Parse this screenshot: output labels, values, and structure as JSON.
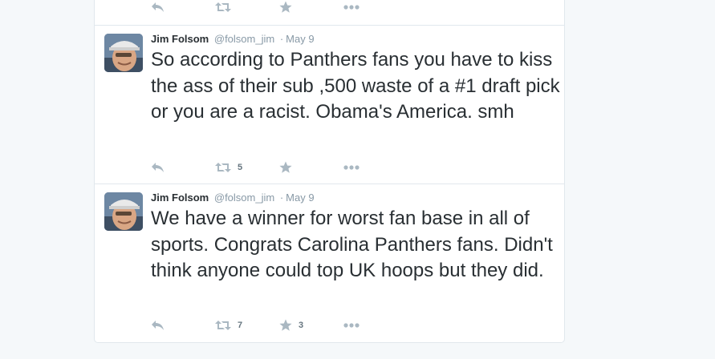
{
  "tweets": [
    {
      "partial": true,
      "retweet_count": "",
      "favorite_count": ""
    },
    {
      "fullname": "Jim Folsom",
      "username": "@folsom_jim",
      "separator": "·",
      "date": "May 9",
      "text": "So according to Panthers fans you have to kiss the ass of their sub ,500 waste of a #1 draft pick or you are a racist. Obama's America. smh",
      "retweet_count": "5",
      "favorite_count": ""
    },
    {
      "fullname": "Jim Folsom",
      "username": "@folsom_jim",
      "separator": "·",
      "date": "May 9",
      "text": "We have a winner for worst fan base in all of sports. Congrats Carolina Panthers fans. Didn't think anyone could top UK hoops but they did.",
      "retweet_count": "7",
      "favorite_count": "3"
    }
  ],
  "colors": {
    "background": "#f5f8fa",
    "text": "#292f33",
    "meta": "#8899a6",
    "action_icon": "#aab8c2",
    "border": "#e1e8ed"
  },
  "icons": {
    "reply": "reply-icon",
    "retweet": "retweet-icon",
    "favorite": "star-icon",
    "more": "more-icon"
  }
}
